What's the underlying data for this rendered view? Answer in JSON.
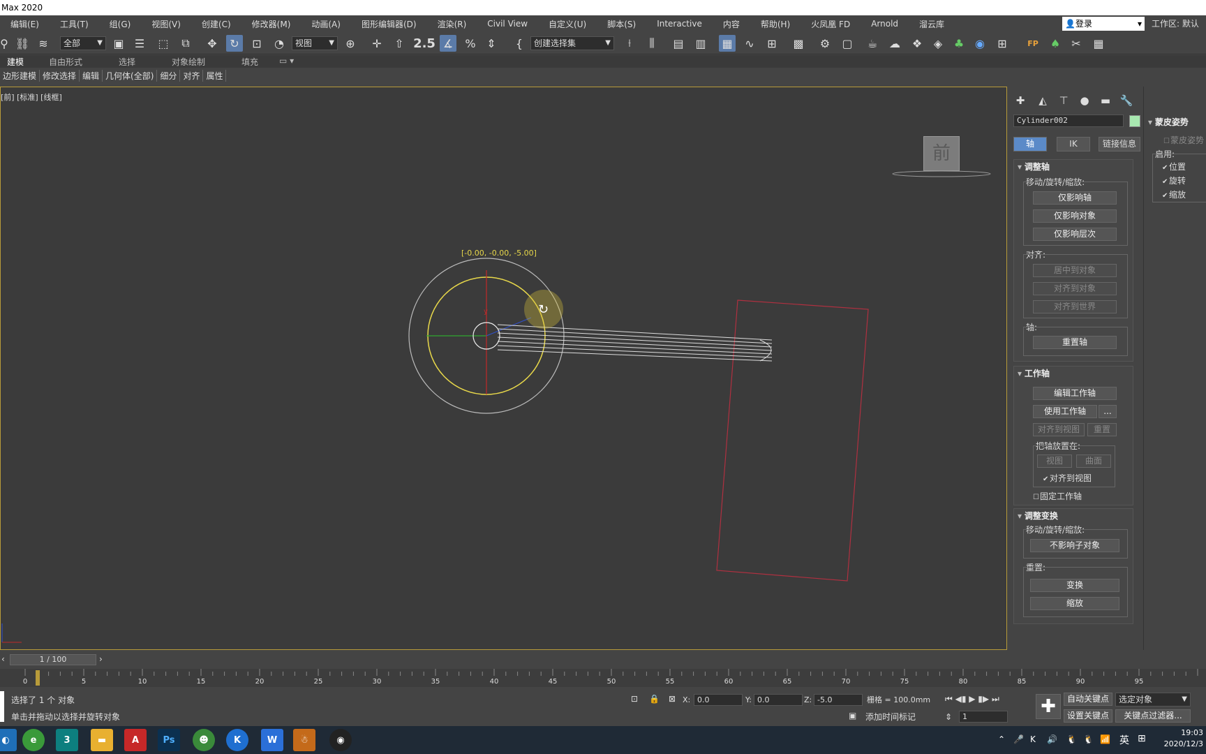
{
  "window": {
    "title": "Max 2020"
  },
  "menu": [
    "编辑(E)",
    "工具(T)",
    "组(G)",
    "视图(V)",
    "创建(C)",
    "修改器(M)",
    "动画(A)",
    "图形编辑器(D)",
    "渲染(R)",
    "Civil View",
    "自定义(U)",
    "脚本(S)",
    "Interactive",
    "内容",
    "帮助(H)",
    "火凤凰 FD",
    "Arnold",
    "溜云库"
  ],
  "login": {
    "label": "登录",
    "icon": "user-icon"
  },
  "workspace": {
    "label": "工作区: 默认"
  },
  "toolbar": {
    "filter_value": "全部",
    "refcoord_value": "视图",
    "selection_set_placeholder": "创建选择集",
    "snap_label": "2.5"
  },
  "ribbon": {
    "tabs": [
      "建模",
      "自由形式",
      "选择",
      "对象绘制",
      "填充"
    ],
    "sub": [
      "边形建模",
      "修改选择",
      "编辑",
      "几何体(全部)",
      "细分",
      "对齐",
      "属性"
    ]
  },
  "viewport": {
    "label": "[前] [标准] [线框]",
    "gizmo_coord": "[-0.00, -0.00, -5.00]",
    "viewcube_label": "前",
    "axis_y": "y",
    "colors": {
      "selection_ring": "#e8d84a",
      "wire": "#ffffff",
      "box": "#b03040",
      "border": "#b89b3a"
    }
  },
  "command_panel": {
    "object_name": "Cylinder002",
    "object_color": "#a8e8b0",
    "tabs": [
      "轴",
      "IK",
      "链接信息"
    ],
    "adjust_pivot": {
      "title": "调整轴",
      "group1_label": "移动/旋转/缩放:",
      "btn_pivot_only": "仅影响轴",
      "btn_object_only": "仅影响对象",
      "btn_hierarchy_only": "仅影响层次",
      "align_label": "对齐:",
      "btn_center": "居中到对象",
      "btn_align_obj": "对齐到对象",
      "btn_align_world": "对齐到世界",
      "pivot_label": "轴:",
      "btn_reset_pivot": "重置轴"
    },
    "working_pivot": {
      "title": "工作轴",
      "btn_edit": "编辑工作轴",
      "btn_use": "使用工作轴",
      "btn_more": "...",
      "btn_align_view": "对齐到视图",
      "btn_reset": "重置",
      "place_label": "把轴放置在:",
      "btn_view": "视图",
      "btn_surface": "曲面",
      "chk_align_view": "对齐到视图",
      "chk_lock": "固定工作轴"
    },
    "adjust_transform": {
      "title": "调整变换",
      "group_label": "移动/旋转/缩放:",
      "btn_dont_affect": "不影响子对象",
      "reset_label": "重置:",
      "btn_transform": "变换",
      "btn_scale": "缩放"
    }
  },
  "skin_pose": {
    "title": "蒙皮姿势",
    "chk_skin": "蒙皮姿势",
    "enable_label": "启用:",
    "chk_pos": "位置",
    "chk_rot": "旋转",
    "chk_scale": "缩放"
  },
  "timeline": {
    "frame": "1 / 100",
    "ticks": [
      "0",
      "5",
      "10",
      "15",
      "20",
      "25",
      "30",
      "35",
      "40",
      "45",
      "50",
      "55",
      "60",
      "65",
      "70",
      "75",
      "80",
      "85",
      "90",
      "95"
    ]
  },
  "status": {
    "selected": "选择了 1 个 对象",
    "hint": "单击并拖动以选择并旋转对象",
    "x_label": "X:",
    "x_value": "0.0",
    "y_label": "Y:",
    "y_value": "0.0",
    "z_label": "Z:",
    "z_value": "-5.0",
    "grid": "栅格 = 100.0mm",
    "add_time_tag": "添加时间标记",
    "auto_key": "自动关键点",
    "set_key": "设置关键点",
    "selected_obj": "选定对象",
    "key_filter": "关键点过滤器...",
    "frame_field": "1"
  },
  "taskbar": {
    "apps": [
      "browser",
      "3",
      "folder",
      "A",
      "Ps",
      "frog",
      "K",
      "W",
      "qq",
      "record"
    ],
    "tray_lang": "英",
    "time": "19:03",
    "date": "2020/12/3"
  }
}
